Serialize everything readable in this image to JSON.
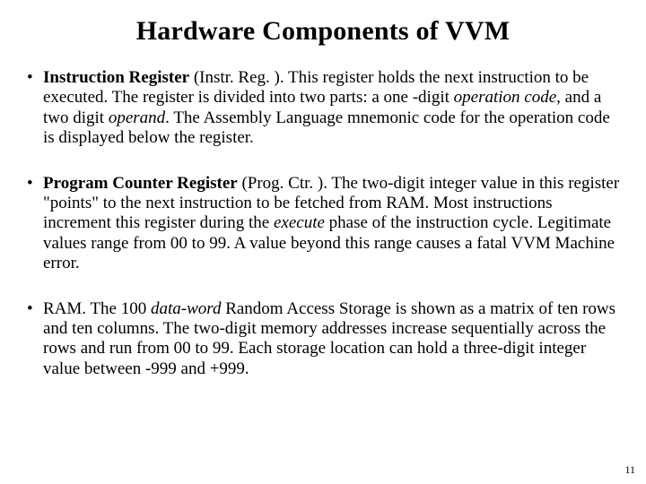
{
  "title": "Hardware Components of VVM",
  "bullets": [
    {
      "lead_bold": "Instruction Register",
      "after_lead": " (Instr. Reg. ). This register holds the next instruction to be executed. The register is divided into two parts: a one -digit ",
      "ital1": "operation code",
      "mid1": ", and a two digit ",
      "ital2": "operand",
      "tail": ". The Assembly Language mnemonic code for the operation code is displayed below the register."
    },
    {
      "lead_bold": "Program Counter Register",
      "after_lead": " (Prog. Ctr. ). The two-digit integer value in this register \"points\" to the next instruction to be fetched from RAM. Most instructions increment this register during the ",
      "ital1": "execute",
      "mid1": " phase of the instruction cycle. Legitimate values range from 00 to 99. A value beyond this range causes a fatal VVM Machine error.",
      "ital2": "",
      "tail": ""
    },
    {
      "lead_bold": "",
      "after_lead": "RAM. The 100 ",
      "ital1": "data-word",
      "mid1": " Random Access Storage is shown as a matrix of ten rows and ten columns. The two-digit memory addresses increase sequentially across the rows and run from 00 to 99. Each storage location can hold a three-digit integer value between -999 and +999.",
      "ital2": "",
      "tail": ""
    }
  ],
  "page_number": "11"
}
